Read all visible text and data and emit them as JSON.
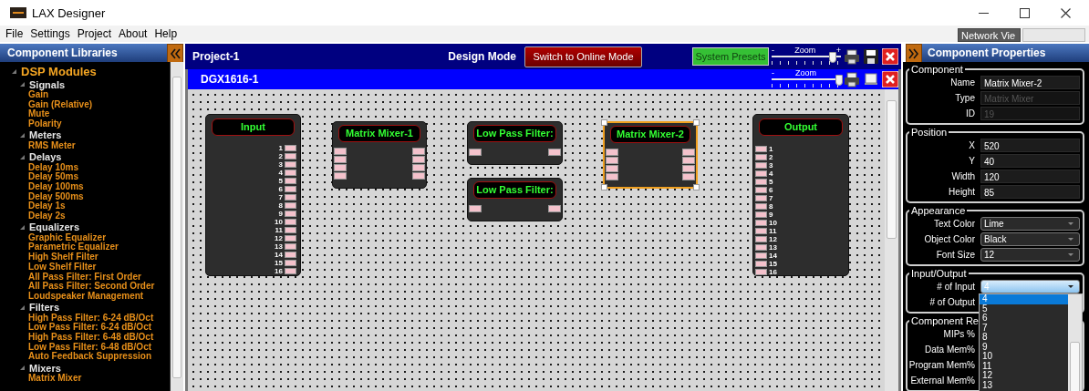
{
  "window": {
    "title": "LAX Designer"
  },
  "menu": [
    "File",
    "Settings",
    "Project",
    "About",
    "Help"
  ],
  "view_tabs": [
    {
      "label": "Network Vie",
      "selected": true
    },
    {
      "selected": false
    }
  ],
  "library": {
    "title": "Component Libraries",
    "tree": [
      {
        "label": "DSP Modules",
        "expanded": true,
        "children": [
          {
            "label": "Signals",
            "expanded": true,
            "children": [
              {
                "label": "Gain"
              },
              {
                "label": "Gain (Relative)"
              },
              {
                "label": "Mute"
              },
              {
                "label": "Polarity"
              }
            ]
          },
          {
            "label": "Meters",
            "expanded": true,
            "children": [
              {
                "label": "RMS Meter"
              }
            ]
          },
          {
            "label": "Delays",
            "expanded": true,
            "children": [
              {
                "label": "Delay 10ms"
              },
              {
                "label": "Delay 50ms"
              },
              {
                "label": "Delay 100ms"
              },
              {
                "label": "Delay 500ms"
              },
              {
                "label": "Delay 1s"
              },
              {
                "label": "Delay 2s"
              }
            ]
          },
          {
            "label": "Equalizers",
            "expanded": true,
            "children": [
              {
                "label": "Graphic Equalizer"
              },
              {
                "label": "Parametric Equalizer"
              },
              {
                "label": "High Shelf Filter"
              },
              {
                "label": "Low Shelf Filter"
              },
              {
                "label": "All Pass Filter: First Order"
              },
              {
                "label": "All Pass Filter: Second Order"
              },
              {
                "label": "Loudspeaker Management"
              }
            ]
          },
          {
            "label": "Filters",
            "expanded": true,
            "children": [
              {
                "label": "High Pass Filter: 6-24 dB/Oct"
              },
              {
                "label": "Low Pass Filter: 6-24 dB/Oct"
              },
              {
                "label": "High Pass Filter: 6-48 dB/Oct"
              },
              {
                "label": "Low Pass Filter: 6-48 dB/Oct"
              },
              {
                "label": "Auto Feedback Suppression"
              }
            ]
          },
          {
            "label": "Mixers",
            "expanded": true,
            "children": [
              {
                "label": "Matrix Mixer"
              }
            ]
          }
        ]
      }
    ]
  },
  "project": {
    "title": "Project-1",
    "mode": "Design Mode",
    "mode_button": "Switch to Online Mode",
    "presets_button": "System Presets",
    "zoom": {
      "minus": "-",
      "label": "Zoom",
      "plus": "+",
      "level": 0.88
    },
    "tools": [
      {
        "kind": "print"
      },
      {
        "kind": "save"
      },
      {
        "kind": "close"
      }
    ]
  },
  "device": {
    "title": "DGX1616-1",
    "zoom": {
      "minus": "-",
      "label": "Zoom",
      "level": 0.97
    },
    "tools": [
      {
        "kind": "print"
      },
      {
        "kind": "window"
      },
      {
        "kind": "close"
      }
    ]
  },
  "canvas": {
    "nodes": [
      {
        "kind": "input",
        "title": "Input",
        "selected": false,
        "ports": [
          {
            "kind": "out",
            "label": "1"
          },
          {
            "kind": "out",
            "label": "2"
          },
          {
            "kind": "out",
            "label": "3"
          },
          {
            "kind": "out",
            "label": "4"
          },
          {
            "kind": "out",
            "label": "5"
          },
          {
            "kind": "out",
            "label": "6"
          },
          {
            "kind": "out",
            "label": "7"
          },
          {
            "kind": "out",
            "label": "8"
          },
          {
            "kind": "out",
            "label": "9"
          },
          {
            "kind": "out",
            "label": "10"
          },
          {
            "kind": "out",
            "label": "11"
          },
          {
            "kind": "out",
            "label": "12"
          },
          {
            "kind": "out",
            "label": "13"
          },
          {
            "kind": "out",
            "label": "14"
          },
          {
            "kind": "out",
            "label": "15"
          },
          {
            "kind": "out",
            "label": "16"
          }
        ]
      },
      {
        "kind": "mixer",
        "title": "Matrix Mixer-1",
        "selected": false,
        "ports": [
          {
            "kind": "in"
          },
          {
            "kind": "in"
          },
          {
            "kind": "in"
          },
          {
            "kind": "in"
          },
          {
            "kind": "out"
          },
          {
            "kind": "out"
          },
          {
            "kind": "out"
          },
          {
            "kind": "out"
          }
        ]
      },
      {
        "kind": "filter",
        "title": "Low Pass Filter:",
        "selected": false,
        "ports": [
          {
            "kind": "in"
          },
          {
            "kind": "out"
          }
        ]
      },
      {
        "kind": "filter",
        "title": "Low Pass Filter:",
        "selected": false,
        "ports": [
          {
            "kind": "in"
          },
          {
            "kind": "out"
          }
        ]
      },
      {
        "kind": "mixer",
        "title": "Matrix Mixer-2",
        "selected": true,
        "ports": [
          {
            "kind": "in"
          },
          {
            "kind": "in"
          },
          {
            "kind": "in"
          },
          {
            "kind": "in"
          },
          {
            "kind": "out"
          },
          {
            "kind": "out"
          },
          {
            "kind": "out"
          },
          {
            "kind": "out"
          }
        ]
      },
      {
        "kind": "output",
        "title": "Output",
        "selected": false,
        "ports": [
          {
            "kind": "in",
            "label": "1"
          },
          {
            "kind": "in",
            "label": "2"
          },
          {
            "kind": "in",
            "label": "3"
          },
          {
            "kind": "in",
            "label": "4"
          },
          {
            "kind": "in",
            "label": "5"
          },
          {
            "kind": "in",
            "label": "6"
          },
          {
            "kind": "in",
            "label": "7"
          },
          {
            "kind": "in",
            "label": "8"
          },
          {
            "kind": "in",
            "label": "9"
          },
          {
            "kind": "in",
            "label": "10"
          },
          {
            "kind": "in",
            "label": "11"
          },
          {
            "kind": "in",
            "label": "12"
          },
          {
            "kind": "in",
            "label": "13"
          },
          {
            "kind": "in",
            "label": "14"
          },
          {
            "kind": "in",
            "label": "15"
          },
          {
            "kind": "in",
            "label": "16"
          }
        ]
      }
    ]
  },
  "properties": {
    "title": "Component Properties",
    "groups": [
      {
        "title": "Component",
        "rows": [
          {
            "label": "Name",
            "kind": "text",
            "value": "Matrix Mixer-2",
            "disabled": false
          },
          {
            "label": "Type",
            "kind": "text",
            "value": "Matrix Mixer",
            "disabled": true
          },
          {
            "label": "ID",
            "kind": "text",
            "value": "19",
            "disabled": true
          }
        ]
      },
      {
        "title": "Position",
        "rows": [
          {
            "label": "X",
            "kind": "text",
            "value": "520",
            "disabled": false
          },
          {
            "label": "Y",
            "kind": "text",
            "value": "40",
            "disabled": false
          },
          {
            "label": "Width",
            "kind": "text",
            "value": "120",
            "disabled": false
          },
          {
            "label": "Height",
            "kind": "text",
            "value": "85",
            "disabled": false
          }
        ]
      },
      {
        "title": "Appearance",
        "rows": [
          {
            "label": "Text Color",
            "kind": "select",
            "value": "Lime",
            "open": false
          },
          {
            "label": "Object Color",
            "kind": "select",
            "value": "Black",
            "open": false
          },
          {
            "label": "Font Size",
            "kind": "select",
            "value": "12",
            "open": false
          }
        ]
      },
      {
        "title": "Input/Output",
        "rows": [
          {
            "label": "# of Input",
            "kind": "select",
            "value": "4",
            "open": true
          },
          {
            "label": "# of Output",
            "kind": "label"
          }
        ]
      },
      {
        "title": "Component Re",
        "rows": [
          {
            "label": "MIPs %",
            "kind": "label"
          },
          {
            "label": "Data Mem%",
            "kind": "label"
          },
          {
            "label": "Program Mem%",
            "kind": "label"
          },
          {
            "label": "External Mem%",
            "kind": "label"
          }
        ]
      }
    ],
    "dropdown": {
      "options": [
        {
          "label": "4",
          "selected": true
        },
        {
          "label": "5",
          "selected": false
        },
        {
          "label": "6",
          "selected": false
        },
        {
          "label": "7",
          "selected": false
        },
        {
          "label": "8",
          "selected": false
        },
        {
          "label": "9",
          "selected": false
        },
        {
          "label": "10",
          "selected": false
        },
        {
          "label": "11",
          "selected": false
        },
        {
          "label": "12",
          "selected": false
        },
        {
          "label": "13",
          "selected": false
        }
      ]
    }
  }
}
